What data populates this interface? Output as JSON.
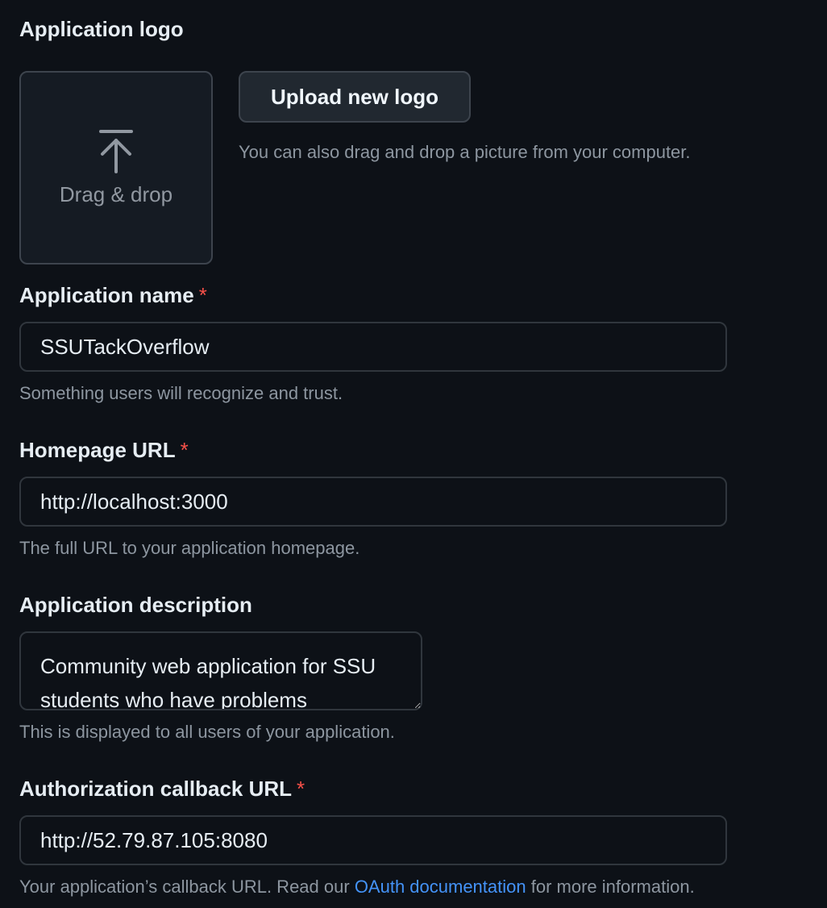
{
  "logo": {
    "label": "Application logo",
    "dropzone_text": "Drag & drop",
    "upload_button": "Upload new logo",
    "hint": "You can also drag and drop a picture from your computer."
  },
  "name": {
    "label": "Application name",
    "required": "*",
    "value": "SSUTackOverflow",
    "hint": "Something users will recognize and trust."
  },
  "homepage": {
    "label": "Homepage URL",
    "required": "*",
    "value": "http://localhost:3000",
    "hint": "The full URL to your application homepage."
  },
  "description": {
    "label": "Application description",
    "value": "Community web application for SSU students who have problems",
    "hint": "This is displayed to all users of your application."
  },
  "callback": {
    "label": "Authorization callback URL",
    "required": "*",
    "value": "http://52.79.87.105:8080",
    "hint_before": "Your application’s callback URL. Read our ",
    "hint_link": "OAuth documentation",
    "hint_after": " for more information."
  },
  "colors": {
    "background": "#0d1117",
    "required": "#f85149",
    "link": "#4493f8"
  }
}
